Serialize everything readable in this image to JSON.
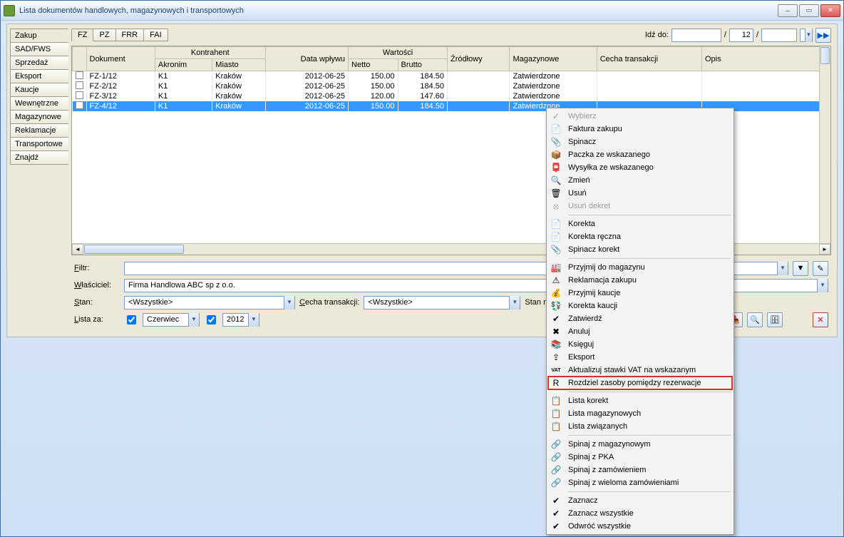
{
  "window": {
    "title": "Lista dokumentów handlowych, magazynowych i transportowych"
  },
  "sidetabs": [
    "Zakup",
    "SAD/FWS",
    "Sprzedaż",
    "Eksport",
    "Kaucje",
    "Wewnętrzne",
    "Magazynowe",
    "Reklamacje",
    "Transportowe",
    "Znajdź"
  ],
  "sidetab_active": 0,
  "subtabs": [
    "FZ",
    "PZ",
    "FRR",
    "FAI"
  ],
  "subtab_active": 0,
  "goto": {
    "label": "Idź do:",
    "first": "",
    "second": "12",
    "third": ""
  },
  "columns": {
    "dokument": "Dokument",
    "kontrahent": "Kontrahent",
    "akronim": "Akronim",
    "miasto": "Miasto",
    "data": "Data wpływu",
    "wartosci": "Wartości",
    "netto": "Netto",
    "brutto": "Brutto",
    "zrodlowy": "Źródłowy",
    "magazynowe": "Magazynowe",
    "cecha": "Cecha transakcji",
    "opis": "Opis"
  },
  "rows": [
    {
      "dok": "FZ-1/12",
      "akr": "K1",
      "miasto": "Kraków",
      "data": "2012-06-25",
      "netto": "150.00",
      "brutto": "184.50",
      "zr": "",
      "mag": "Zatwierdzone",
      "sel": false
    },
    {
      "dok": "FZ-2/12",
      "akr": "K1",
      "miasto": "Kraków",
      "data": "2012-06-25",
      "netto": "150.00",
      "brutto": "184.50",
      "zr": "",
      "mag": "Zatwierdzone",
      "sel": false
    },
    {
      "dok": "FZ-3/12",
      "akr": "K1",
      "miasto": "Kraków",
      "data": "2012-06-25",
      "netto": "120.00",
      "brutto": "147.60",
      "zr": "",
      "mag": "Zatwierdzone",
      "sel": false
    },
    {
      "dok": "FZ-4/12",
      "akr": "K1",
      "miasto": "Kraków",
      "data": "2012-06-25",
      "netto": "150.00",
      "brutto": "184.50",
      "zr": "",
      "mag": "Zatwierdzone",
      "sel": true
    }
  ],
  "filters": {
    "filtr_label": "Filtr:",
    "wlasciciel_label": "Właściciel:",
    "wlasciciel_value": "Firma Handlowa ABC sp z o.o.",
    "stan_label": "Stan:",
    "stan_value": "<Wszystkie>",
    "cecha_label": "Cecha transakcji:",
    "cecha_value": "<Wszystkie>",
    "stanmag_label": "Stan magazynowych:",
    "listaza_label": "Lista za:",
    "listaza_month": "Czerwiec",
    "listaza_year": "2012"
  },
  "context_menu": [
    {
      "type": "item",
      "label": "Wybierz",
      "icon": "✓",
      "disabled": true
    },
    {
      "type": "item",
      "label": "Faktura zakupu",
      "icon": "📄"
    },
    {
      "type": "item",
      "label": "Spinacz",
      "icon": "📎"
    },
    {
      "type": "item",
      "label": "Paczka  ze wskazanego",
      "icon": "📦"
    },
    {
      "type": "item",
      "label": "Wysyłka  ze wskazanego",
      "icon": "📮"
    },
    {
      "type": "item",
      "label": "Zmień",
      "icon": "🔍"
    },
    {
      "type": "item",
      "label": "Usuń",
      "icon": "🗑"
    },
    {
      "type": "item",
      "label": "Usuń dekret",
      "icon": "⦻",
      "disabled": true
    },
    {
      "type": "sep"
    },
    {
      "type": "item",
      "label": "Korekta",
      "icon": "📄"
    },
    {
      "type": "item",
      "label": "Korekta ręczna",
      "icon": "📄"
    },
    {
      "type": "item",
      "label": "Spinacz korekt",
      "icon": "📎"
    },
    {
      "type": "sep"
    },
    {
      "type": "item",
      "label": "Przyjmij do magazynu",
      "icon": "🏭"
    },
    {
      "type": "item",
      "label": "Reklamacja zakupu",
      "icon": "⚠"
    },
    {
      "type": "item",
      "label": "Przyjmij kaucje",
      "icon": "💰"
    },
    {
      "type": "item",
      "label": "Korekta kaucji",
      "icon": "💱"
    },
    {
      "type": "item",
      "label": "Zatwierdź",
      "icon": "✔"
    },
    {
      "type": "item",
      "label": "Anuluj",
      "icon": "✖"
    },
    {
      "type": "item",
      "label": "Księguj",
      "icon": "📚"
    },
    {
      "type": "item",
      "label": "Eksport",
      "icon": "⇪"
    },
    {
      "type": "item",
      "label": "Aktualizuj stawki VAT na wskazanym",
      "icon": "VAT"
    },
    {
      "type": "item",
      "label": "Rozdziel zasoby pomiędzy rezerwacje",
      "icon": "R",
      "highlight": true
    },
    {
      "type": "sep"
    },
    {
      "type": "item",
      "label": "Lista korekt",
      "icon": "📋"
    },
    {
      "type": "item",
      "label": "Lista magazynowych",
      "icon": "📋"
    },
    {
      "type": "item",
      "label": "Lista związanych",
      "icon": "📋"
    },
    {
      "type": "sep"
    },
    {
      "type": "item",
      "label": "Spinaj z magazynowym",
      "icon": "🔗"
    },
    {
      "type": "item",
      "label": "Spinaj z PKA",
      "icon": "🔗"
    },
    {
      "type": "item",
      "label": "Spinaj z zamówieniem",
      "icon": "🔗"
    },
    {
      "type": "item",
      "label": "Spinaj z wieloma zamówieniami",
      "icon": "🔗"
    },
    {
      "type": "sep"
    },
    {
      "type": "item",
      "label": "Zaznacz",
      "icon": "✔"
    },
    {
      "type": "item",
      "label": "Zaznacz wszystkie",
      "icon": "✔"
    },
    {
      "type": "item",
      "label": "Odwróć wszystkie",
      "icon": "✔"
    }
  ]
}
